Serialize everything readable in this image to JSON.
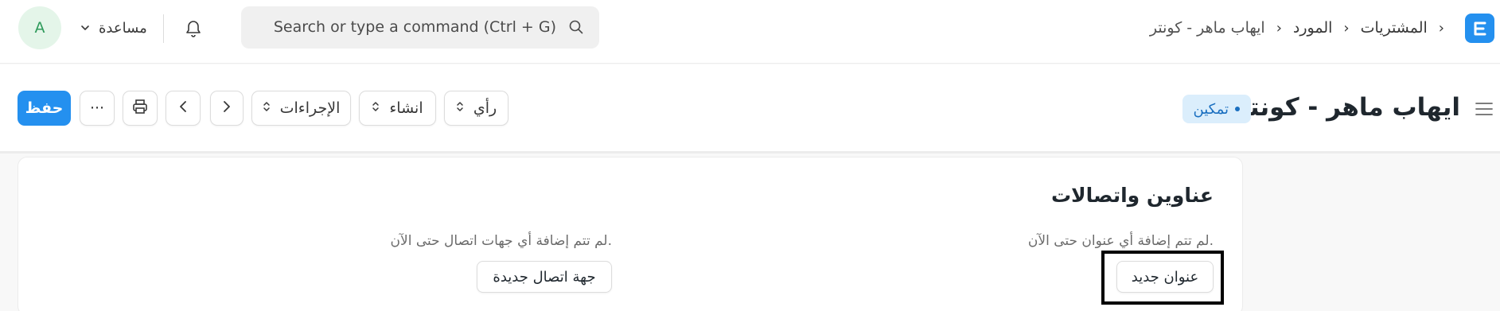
{
  "navbar": {
    "avatar_initial": "A",
    "help_label": "مساعدة",
    "search_placeholder": "Search or type a command (Ctrl + G)",
    "breadcrumbs": [
      "المشتريات",
      "المورد",
      "ايهاب ماهر - كونتر"
    ],
    "breadcrumb_separator": "›"
  },
  "page": {
    "title": "ايهاب ماهر - كونتر",
    "status": "تمكين",
    "buttons": {
      "save": "حفظ",
      "more": "···",
      "actions": "الإجراءات",
      "create": "انشاء",
      "view": "رأي"
    }
  },
  "card": {
    "title": "عناوين واتصالات",
    "no_address": "لم تتم إضافة أي عنوان حتى الآن.",
    "new_address": "عنوان جديد",
    "no_contact": "لم تتم إضافة أي جهات اتصال حتى الآن.",
    "new_contact": "جهة اتصال جديدة"
  },
  "colors": {
    "primary": "#2490ef",
    "status_bg": "#dbeefc",
    "status_fg": "#1a6fc0",
    "avatar_bg": "#e4f5e9",
    "avatar_fg": "#2e9a5b"
  },
  "icons": [
    "logo-icon",
    "hamburger-icon",
    "bell-icon",
    "search-icon",
    "chevron-down-icon",
    "print-icon",
    "chevron-left-icon",
    "chevron-right-icon",
    "sort-updown-icon"
  ]
}
